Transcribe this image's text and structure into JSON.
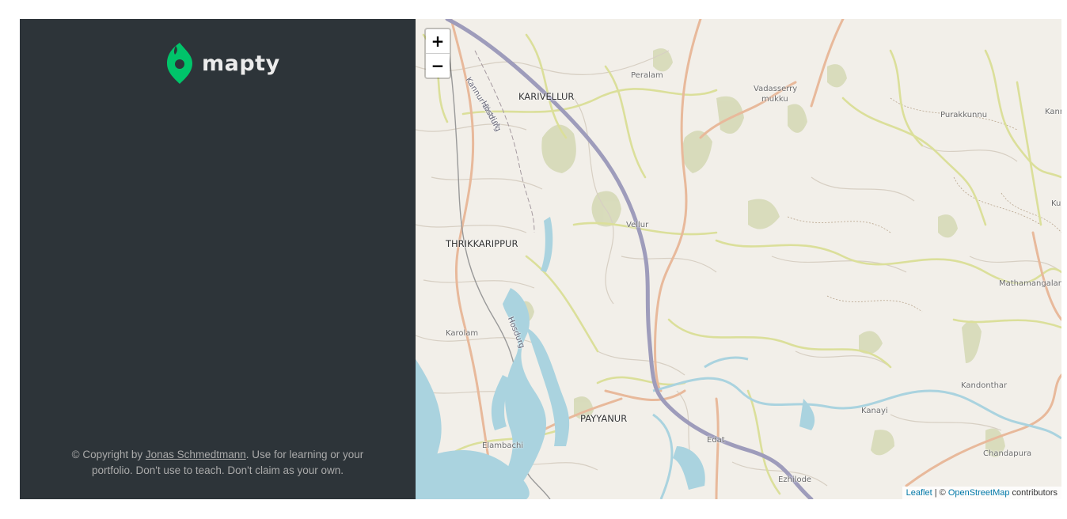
{
  "sidebar": {
    "logo_text": "mapty",
    "copyright": {
      "prefix": "© Copyright by ",
      "author_link": "Jonas Schmedtmann",
      "suffix": ". Use for learning or your portfolio. Don't use to teach. Don't claim as your own."
    }
  },
  "map": {
    "zoom_in": "+",
    "zoom_out": "−",
    "attribution": {
      "leaflet": "Leaflet",
      "separator": " | © ",
      "osm": "OpenStreetMap",
      "suffix": " contributors"
    },
    "labels": {
      "karivellur": "KARIVELLUR",
      "peralam": "Peralam",
      "vadasserry": "Vadasserry",
      "mukku": "mukku",
      "purakkunnu": "Purakkunnu",
      "kannur_district": "Kannur district",
      "hosdurg1": "Hosdurg",
      "hosdurg2": "Hosdurg",
      "thrikkarippur": "THRIKKARIPPUR",
      "vellur": "Vellur",
      "mathamangalam": "Mathamangalam",
      "karolam": "Karolam",
      "kandonthar": "Kandonthar",
      "kanayi": "Kanayi",
      "payyanur": "PAYYANUR",
      "edat": "Edat",
      "elambachi": "Elambachi",
      "chandapura": "Chandapura",
      "ezhilode": "Ezhilode",
      "kanr": "Kanr",
      "ku": "Ku"
    }
  },
  "colors": {
    "sidebar_bg": "#2d3439",
    "brand_green": "#00c46a",
    "map_bg": "#f2efe9",
    "water": "#aad3df",
    "highway": "#9e9cbb"
  }
}
